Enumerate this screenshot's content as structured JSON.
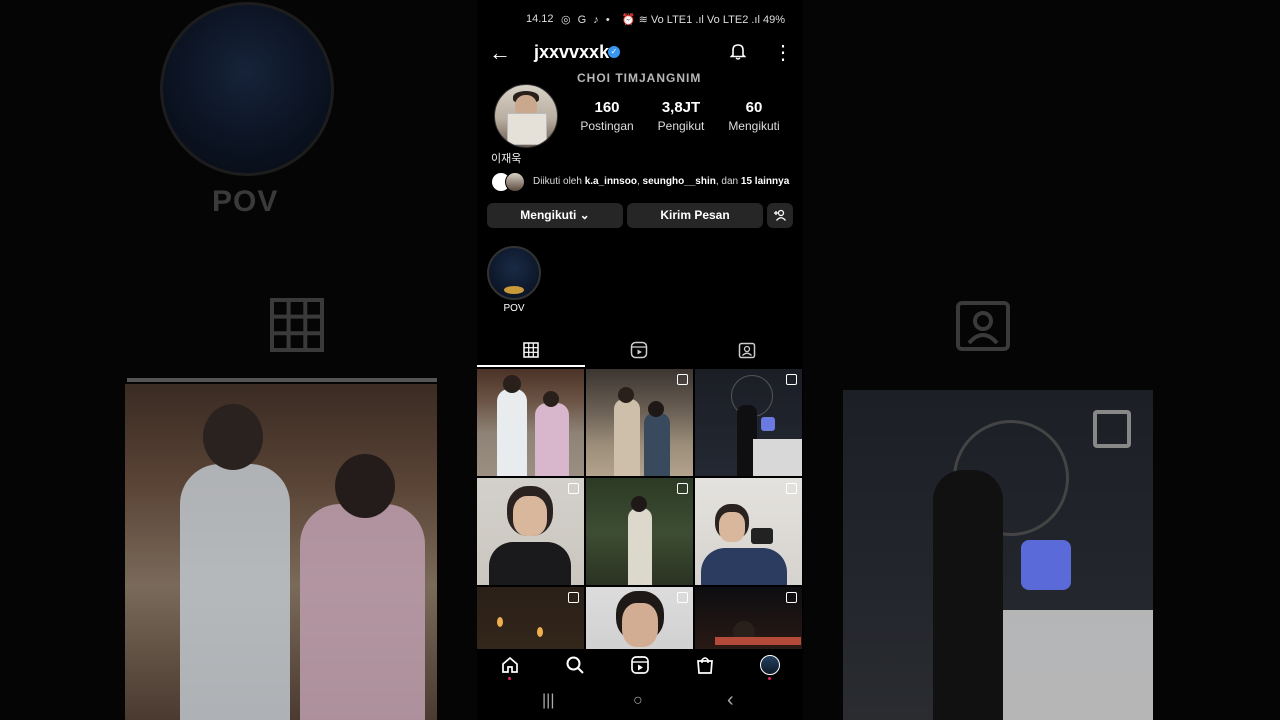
{
  "status": {
    "time": "14.12",
    "left_icons": "◎ G ♪ •",
    "right_icons": "⏰ ≋ Vo LTE1 .ıl Vo LTE2 .ıl 49%"
  },
  "header": {
    "username": "jxxvvxxk",
    "back_icon": "arrow-left-icon",
    "bell_icon": "bell-icon",
    "more_icon": "more-vertical-icon"
  },
  "profile": {
    "stamp_text": "CHOI TIMJANGNIM",
    "bio_name": "이재욱",
    "stats": [
      {
        "value": "160",
        "label": "Postingan"
      },
      {
        "value": "3,8JT",
        "label": "Pengikut"
      },
      {
        "value": "60",
        "label": "Mengikuti"
      }
    ],
    "followed_by": {
      "prefix": "Diikuti oleh ",
      "user1": "k.a_innsoo",
      "sep": ", ",
      "user2": "seungho__shin",
      "middle": ", dan ",
      "others": "15 lainnya"
    }
  },
  "actions": {
    "following_label": "Mengikuti ⌄",
    "message_label": "Kirim Pesan",
    "add_user_icon": "person-plus-icon"
  },
  "highlights": [
    {
      "label": "POV"
    }
  ],
  "tabs": [
    {
      "name": "grid",
      "icon": "grid-icon",
      "glyph": "▦",
      "active": true
    },
    {
      "name": "reels",
      "icon": "reels-icon",
      "glyph": "▶",
      "active": false
    },
    {
      "name": "tagged",
      "icon": "tagged-icon",
      "glyph": "◫",
      "active": false
    }
  ],
  "bottom_nav": [
    {
      "name": "home",
      "glyph": "⌂"
    },
    {
      "name": "search",
      "glyph": "⚲"
    },
    {
      "name": "reels",
      "glyph": "▶"
    },
    {
      "name": "shop",
      "glyph": "⛉"
    },
    {
      "name": "profile",
      "glyph": "●"
    }
  ],
  "system_nav": {
    "recents": "|||",
    "home": "○",
    "back": "‹"
  },
  "background": {
    "left_label": "POV"
  }
}
